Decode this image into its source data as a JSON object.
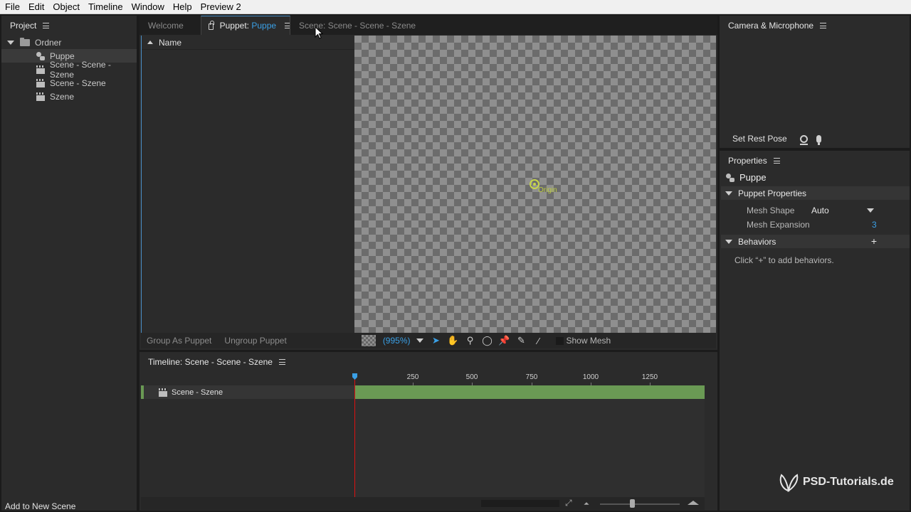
{
  "menu": [
    "File",
    "Edit",
    "Object",
    "Timeline",
    "Window",
    "Help",
    "Preview 2"
  ],
  "project": {
    "title": "Project",
    "folder": "Ordner",
    "items": [
      "Puppe",
      "Scene - Scene - Szene",
      "Scene - Szene",
      "Szene"
    ],
    "footer": "Add to New Scene"
  },
  "tabs": {
    "welcome": "Welcome",
    "puppet_prefix": "Puppet:",
    "puppet_name": "Puppe",
    "scene": "Scene: Scene - Scene - Szene"
  },
  "layers": {
    "column": "Name"
  },
  "canvas": {
    "origin_label": "Origin"
  },
  "puppet_bar": {
    "group": "Group As Puppet",
    "ungroup": "Ungroup Puppet",
    "zoom": "(995%)",
    "show_mesh": "Show Mesh"
  },
  "timeline": {
    "title": "Timeline: Scene - Scene - Szene",
    "ticks": [
      "250",
      "500",
      "750",
      "1000",
      "1250"
    ],
    "track": "Scene - Szene"
  },
  "camera": {
    "title": "Camera & Microphone",
    "set_rest_pose": "Set Rest Pose"
  },
  "properties": {
    "title": "Properties",
    "object": "Puppe",
    "section_puppet": "Puppet Properties",
    "mesh_shape_label": "Mesh Shape",
    "mesh_shape_value": "Auto",
    "mesh_expansion_label": "Mesh Expansion",
    "mesh_expansion_value": "3",
    "section_behaviors": "Behaviors",
    "hint": "Click “+” to add behaviors."
  },
  "watermark": "PSD-Tutorials.de",
  "colors": {
    "accent": "#3aa0e6",
    "track": "#6a9a54",
    "playhead": "#dd1111",
    "origin": "#c7d64a"
  }
}
